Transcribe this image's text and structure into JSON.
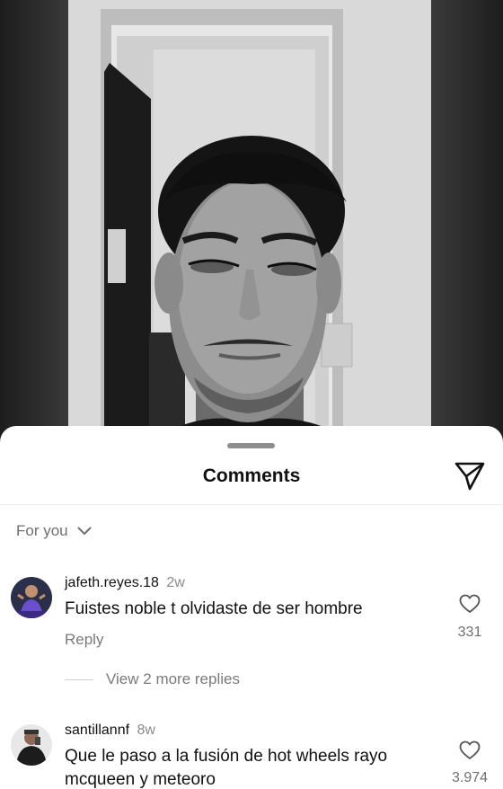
{
  "sheet": {
    "title": "Comments",
    "share_icon": "paper-plane-icon",
    "filter_label": "For you",
    "filter_icon": "chevron-down-icon"
  },
  "comments": [
    {
      "username": "jafeth.reyes.18",
      "time": "2w",
      "text": "Fuistes noble t olvidaste de ser hombre",
      "reply_label": "Reply",
      "likes": "331",
      "more_replies": "View 2 more replies"
    },
    {
      "username": "santillannf",
      "time": "8w",
      "text": "Que le paso a la fusión de hot wheels rayo mcqueen y meteoro",
      "likes": "3.974"
    }
  ],
  "colors": {
    "sheet_bg": "#ffffff",
    "text_primary": "#111111",
    "text_secondary": "#7a7a7a"
  }
}
